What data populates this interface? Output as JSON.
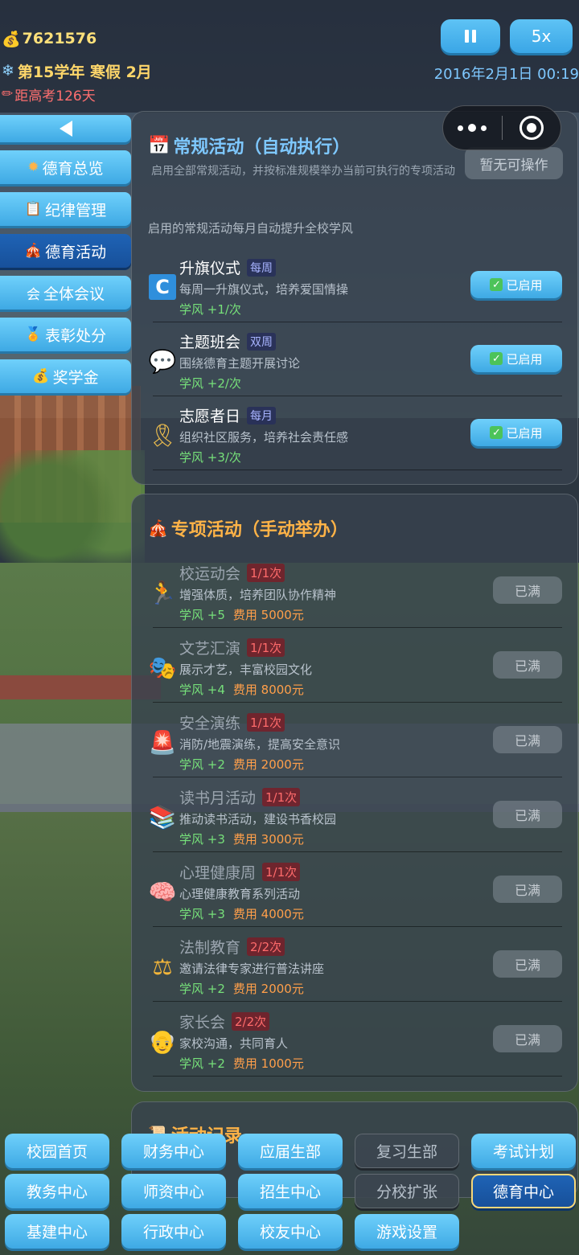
{
  "status": {
    "money": "7621576",
    "term": "第15学年 寒假 2月",
    "exam_countdown": "距高考126天",
    "date": "2016年2月1日 00:19",
    "pause_icon": "pause-icon",
    "speed": "5x"
  },
  "menu": {
    "back_icon": "back-arrow-icon",
    "items": [
      {
        "icon": "✹",
        "label": "德育总览"
      },
      {
        "icon": "📋",
        "label": "纪律管理"
      },
      {
        "icon": "🎪",
        "label": "德育活动"
      },
      {
        "icon": "会",
        "label": "全体会议"
      },
      {
        "icon": "🏅",
        "label": "表彰处分"
      },
      {
        "icon": "💰",
        "label": "奖学金"
      }
    ],
    "active_index": 2
  },
  "regular": {
    "title": "常规活动（自动执行）",
    "desc": "启用全部常规活动，并按标准规模举办当前可执行的专项活动",
    "no_op": "暂无可操作",
    "note": "启用的常规活动每月自动提升全校学风",
    "items": [
      {
        "icon": "C",
        "name": "升旗仪式",
        "freq": "每周",
        "desc": "每周一升旗仪式，培养爱国情操",
        "gain": "学风 +1/次",
        "button": "已启用"
      },
      {
        "icon": "💬",
        "name": "主题班会",
        "freq": "双周",
        "desc": "围绕德育主题开展讨论",
        "gain": "学风 +2/次",
        "button": "已启用"
      },
      {
        "icon": "🎗",
        "name": "志愿者日",
        "freq": "每月",
        "desc": "组织社区服务，培养社会责任感",
        "gain": "学风 +3/次",
        "button": "已启用"
      }
    ]
  },
  "special": {
    "title": "专项活动（手动举办）",
    "items": [
      {
        "icon": "🏃",
        "name": "校运动会",
        "count": "1/1次",
        "desc": "增强体质，培养团队协作精神",
        "gain": "学风 +5",
        "cost": "费用 5000元",
        "button": "已满"
      },
      {
        "icon": "🎭",
        "name": "文艺汇演",
        "count": "1/1次",
        "desc": "展示才艺，丰富校园文化",
        "gain": "学风 +4",
        "cost": "费用 8000元",
        "button": "已满"
      },
      {
        "icon": "🚨",
        "name": "安全演练",
        "count": "1/1次",
        "desc": "消防/地震演练，提高安全意识",
        "gain": "学风 +2",
        "cost": "费用 2000元",
        "button": "已满"
      },
      {
        "icon": "📚",
        "name": "读书月活动",
        "count": "1/1次",
        "desc": "推动读书活动，建设书香校园",
        "gain": "学风 +3",
        "cost": "费用 3000元",
        "button": "已满"
      },
      {
        "icon": "🧠",
        "name": "心理健康周",
        "count": "1/1次",
        "desc": "心理健康教育系列活动",
        "gain": "学风 +3",
        "cost": "费用 4000元",
        "button": "已满"
      },
      {
        "icon": "⚖",
        "name": "法制教育",
        "count": "2/2次",
        "desc": "邀请法律专家进行普法讲座",
        "gain": "学风 +2",
        "cost": "费用 2000元",
        "button": "已满"
      },
      {
        "icon": "👴",
        "name": "家长会",
        "count": "2/2次",
        "desc": "家校沟通，共同育人",
        "gain": "学风 +2",
        "cost": "费用 1000元",
        "button": "已满"
      }
    ]
  },
  "log": {
    "title": "活动记录"
  },
  "nav": {
    "rows": [
      [
        {
          "label": "校园首页",
          "state": "normal"
        },
        {
          "label": "财务中心",
          "state": "normal"
        },
        {
          "label": "应届生部",
          "state": "normal"
        },
        {
          "label": "复习生部",
          "state": "disabled"
        },
        {
          "label": "考试计划",
          "state": "normal"
        }
      ],
      [
        {
          "label": "教务中心",
          "state": "normal"
        },
        {
          "label": "师资中心",
          "state": "normal"
        },
        {
          "label": "招生中心",
          "state": "normal"
        },
        {
          "label": "分校扩张",
          "state": "disabled"
        },
        {
          "label": "德育中心",
          "state": "current"
        }
      ],
      [
        {
          "label": "基建中心",
          "state": "normal"
        },
        {
          "label": "行政中心",
          "state": "normal"
        },
        {
          "label": "校友中心",
          "state": "normal"
        },
        {
          "label": "游戏设置",
          "state": "normal"
        }
      ]
    ]
  }
}
